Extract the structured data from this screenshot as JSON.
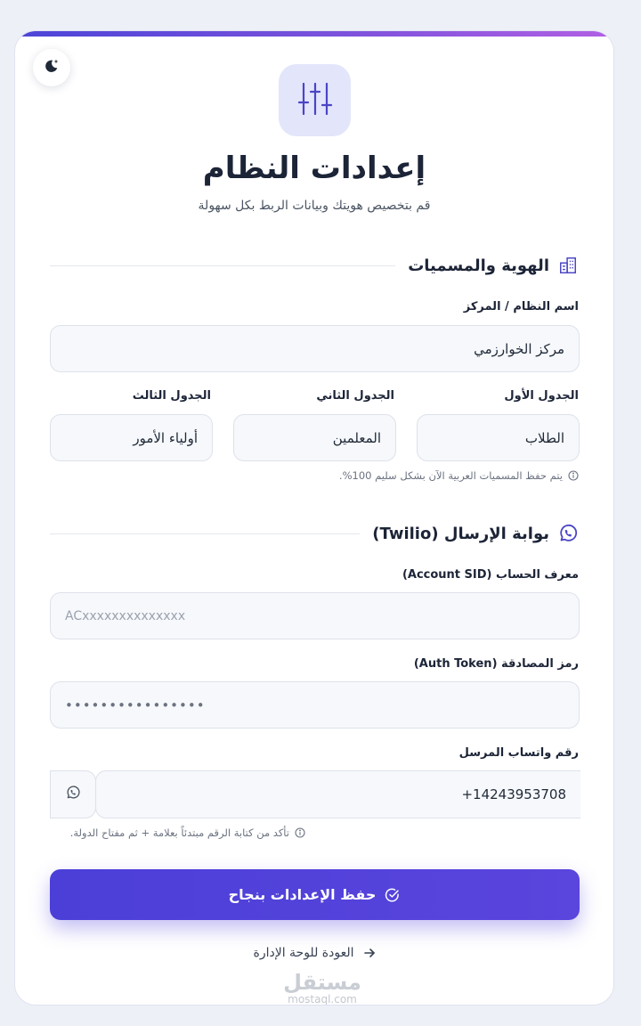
{
  "header": {
    "title": "إعدادات النظام",
    "subtitle": "قم بتخصيص هويتك وبيانات الربط بكل سهولة",
    "theme_toggle_icon": "moon-sparkle-icon",
    "hero_icon": "sliders-icon"
  },
  "identity_section": {
    "title": "الهوية والمسميات",
    "icon": "building-icon",
    "system_name": {
      "label": "اسم النظام / المركز",
      "value": "مركز الخوارزمي"
    },
    "table1": {
      "label": "الجدول الأول",
      "value": "الطلاب"
    },
    "table2": {
      "label": "الجدول الثاني",
      "value": "المعلمين"
    },
    "table3": {
      "label": "الجدول الثالث",
      "value": "أولياء الأمور"
    },
    "hint": "يتم حفظ المسميات العربية الآن بشكل سليم 100%."
  },
  "gateway_section": {
    "title": "بوابة الإرسال (Twilio)",
    "icon": "whatsapp-icon",
    "account_sid": {
      "label": "معرف الحساب (Account SID)",
      "placeholder": "ACxxxxxxxxxxxxxx"
    },
    "auth_token": {
      "label": "رمز المصادقة (Auth Token)",
      "value": "••••••••••••••••"
    },
    "sender_number": {
      "label": "رقم واتساب المرسل",
      "value": "+14243953708"
    },
    "hint": "تأكد من كتابة الرقم مبتدئاً بعلامة + ثم مفتاح الدولة."
  },
  "actions": {
    "save_label": "حفظ الإعدادات بنجاح",
    "back_label": "العودة للوحة الإدارة"
  },
  "watermark": {
    "main": "مستقل",
    "sub": "mostaql.com"
  },
  "colors": {
    "accent": "#4b3fd8",
    "accent_soft": "#e3e5fb",
    "gradient_end": "#b15fe4",
    "background": "#eef0f8"
  }
}
